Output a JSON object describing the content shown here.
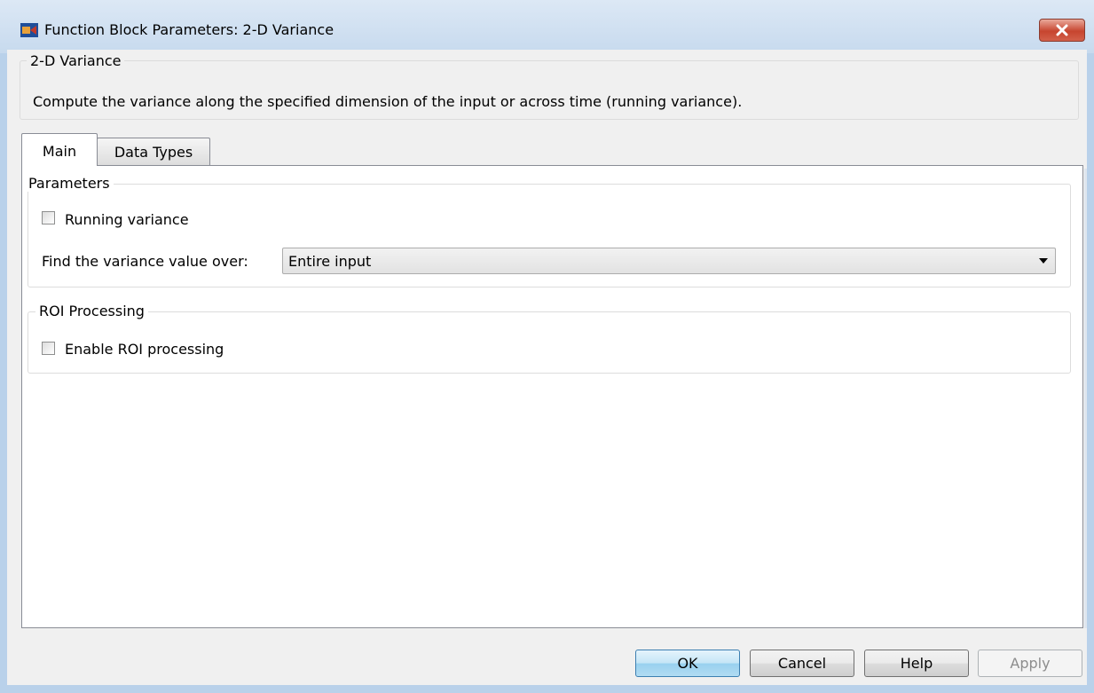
{
  "window": {
    "title": "Function Block Parameters: 2-D Variance",
    "close_symbol": "×"
  },
  "description": {
    "group_title": "2-D Variance",
    "text": "Compute the variance along the specified dimension of the input or across time (running variance)."
  },
  "tabs": [
    {
      "label": "Main",
      "selected": true
    },
    {
      "label": "Data Types",
      "selected": false
    }
  ],
  "parameters": {
    "group_title": "Parameters",
    "running_variance": {
      "label": "Running variance",
      "checked": false
    },
    "find_over": {
      "label": "Find the variance value over:",
      "value": "Entire input"
    }
  },
  "roi": {
    "group_title": "ROI Processing",
    "enable": {
      "label": "Enable ROI processing",
      "checked": false
    }
  },
  "buttons": {
    "ok": "OK",
    "cancel": "Cancel",
    "help": "Help",
    "apply": "Apply"
  },
  "colors": {
    "window_frame": "#b9d1ea",
    "dialog_bg": "#f0f0f0",
    "ok_accent": "#3c7fb1",
    "close_red": "#c7452f"
  },
  "icons": {
    "app": "simulink-block-icon",
    "close": "close-icon",
    "dropdown": "chevron-down-icon"
  }
}
